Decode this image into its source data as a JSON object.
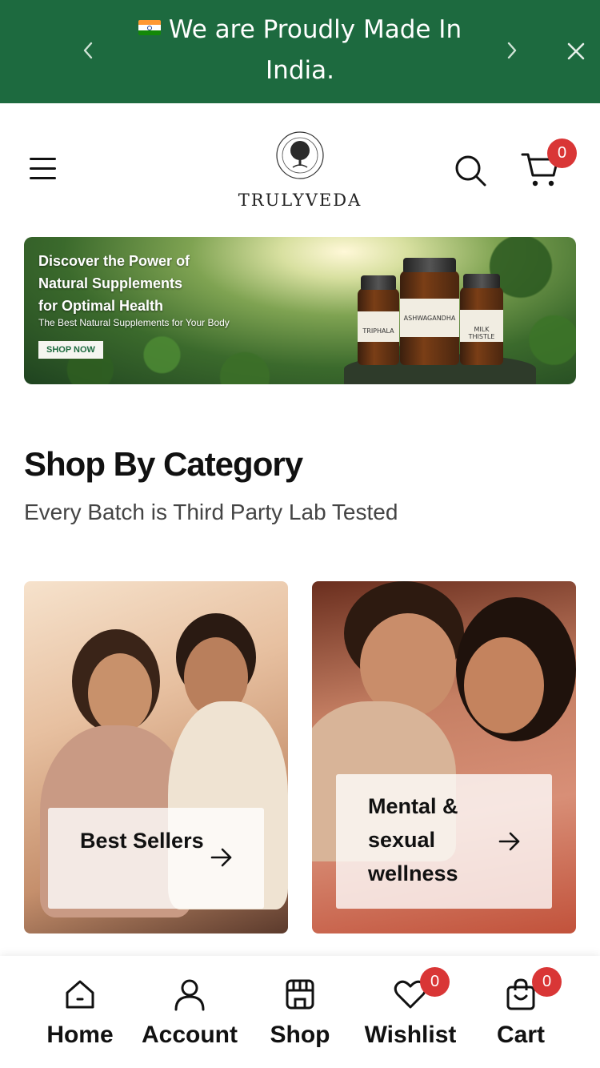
{
  "announcement": {
    "message": "We are Proudly Made In India.",
    "flag_icon": "india-flag-icon",
    "prev_icon": "chevron-left-icon",
    "next_icon": "chevron-right-icon",
    "close_icon": "close-icon",
    "background": "#1d6a3f"
  },
  "header": {
    "brand": "TRULYVEDA",
    "menu_icon": "hamburger-menu-icon",
    "search_icon": "search-icon",
    "cart_icon": "cart-icon",
    "cart_count": "0"
  },
  "banner": {
    "headline_line1": "Discover the Power of",
    "headline_line2": "Natural Supplements",
    "headline_line3": "for Optimal Health",
    "subtext": "The Best Natural Supplements for Your Body",
    "cta": "SHOP NOW",
    "products": [
      "TRIPHALA",
      "ASHWAGANDHA",
      "MILK THISTLE"
    ]
  },
  "category_section": {
    "title": "Shop By Category",
    "subtitle": "Every Batch is Third Party Lab Tested",
    "cards": [
      {
        "label": "Best Sellers",
        "arrow_icon": "arrow-right-icon"
      },
      {
        "label": "Mental & sexual wellness",
        "arrow_icon": "arrow-right-icon"
      }
    ]
  },
  "bottom_nav": {
    "items": [
      {
        "label": "Home",
        "icon": "home-icon"
      },
      {
        "label": "Account",
        "icon": "user-icon"
      },
      {
        "label": "Shop",
        "icon": "store-icon"
      },
      {
        "label": "Wishlist",
        "icon": "heart-icon",
        "count": "0"
      },
      {
        "label": "Cart",
        "icon": "shopping-bag-icon",
        "count": "0"
      }
    ],
    "badge_color": "#d93636"
  }
}
